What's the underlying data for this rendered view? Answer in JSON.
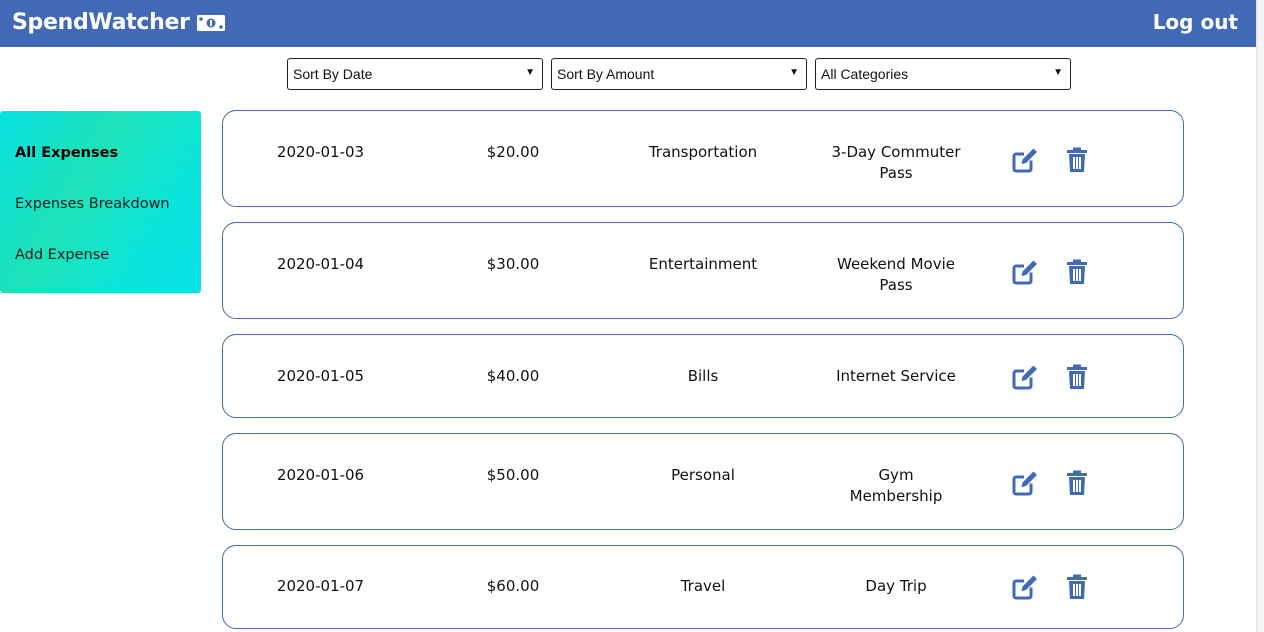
{
  "app": {
    "title": "SpendWatcher",
    "logout_label": "Log out",
    "colors": {
      "navbar": "#4169b5",
      "accent": "#4169b5",
      "sidebar_gradient": [
        "#08e0e2",
        "#1ee3b8"
      ]
    }
  },
  "filters": {
    "sort_date": {
      "value": "Sort By Date"
    },
    "sort_amount": {
      "value": "Sort By Amount"
    },
    "category": {
      "value": "All Categories"
    }
  },
  "sidebar": {
    "items": [
      {
        "label": "All Expenses",
        "active": true
      },
      {
        "label": "Expenses Breakdown",
        "active": false
      },
      {
        "label": "Add Expense",
        "active": false
      }
    ]
  },
  "expenses": [
    {
      "date": "2020-01-03",
      "amount": "$20.00",
      "category": "Transportation",
      "description_lines": [
        "3-Day Commuter",
        "Pass"
      ]
    },
    {
      "date": "2020-01-04",
      "amount": "$30.00",
      "category": "Entertainment",
      "description_lines": [
        "Weekend Movie",
        "Pass"
      ]
    },
    {
      "date": "2020-01-05",
      "amount": "$40.00",
      "category": "Bills",
      "description_lines": [
        "Internet Service"
      ]
    },
    {
      "date": "2020-01-06",
      "amount": "$50.00",
      "category": "Personal",
      "description_lines": [
        "Gym",
        "Membership"
      ]
    },
    {
      "date": "2020-01-07",
      "amount": "$60.00",
      "category": "Travel",
      "description_lines": [
        "Day Trip"
      ]
    }
  ],
  "icons": {
    "brand": "money-bill-icon",
    "edit": "edit-icon",
    "delete": "trash-icon",
    "dropdown": "caret-down-icon"
  }
}
